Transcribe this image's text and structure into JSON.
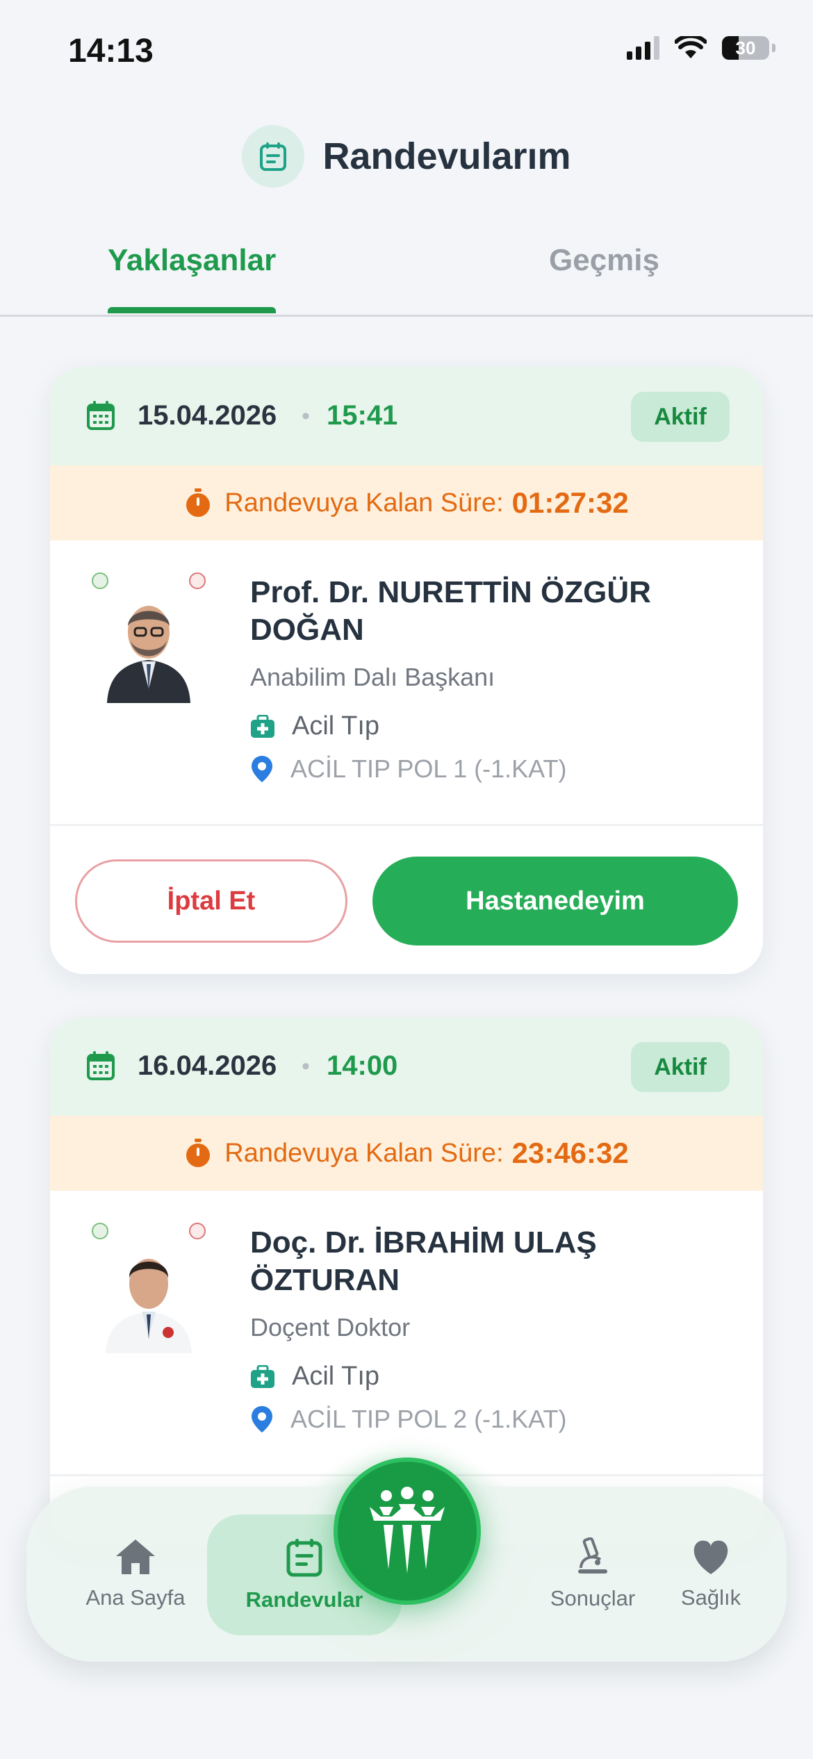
{
  "status_bar": {
    "time": "14:13",
    "battery": "30"
  },
  "header": {
    "title": "Randevularım"
  },
  "tabs": [
    {
      "label": "Yaklaşanlar",
      "active": true
    },
    {
      "label": "Geçmiş",
      "active": false
    }
  ],
  "appointments": [
    {
      "date": "15.04.2026",
      "separator": "•",
      "time": "15:41",
      "status": "Aktif",
      "countdown_label": "Randevuya Kalan Süre:",
      "countdown_value": "01:27:32",
      "doctor_name": "Prof. Dr. NURETTİN ÖZGÜR DOĞAN",
      "doctor_title": "Anabilim Dalı Başkanı",
      "department": "Acil Tıp",
      "location": "ACİL TIP POL 1 (-1.KAT)",
      "cancel_label": "İptal Et",
      "checkin_label": "Hastanedeyim"
    },
    {
      "date": "16.04.2026",
      "separator": "•",
      "time": "14:00",
      "status": "Aktif",
      "countdown_label": "Randevuya Kalan Süre:",
      "countdown_value": "23:46:32",
      "doctor_name": "Doç. Dr. İBRAHİM ULAŞ ÖZTURAN",
      "doctor_title": "Doçent Doktor",
      "department": "Acil Tıp",
      "location": "ACİL TIP POL 2 (-1.KAT)"
    }
  ],
  "bottom_nav": {
    "home": "Ana Sayfa",
    "appointments": "Randevular",
    "results": "Sonuçlar",
    "health": "Sağlık"
  },
  "colors": {
    "primary_green": "#1f9a4d",
    "button_green": "#26ad58",
    "countdown_orange": "#e36a12",
    "cancel_red": "#dc3b3f",
    "location_blue": "#2b7de0"
  }
}
